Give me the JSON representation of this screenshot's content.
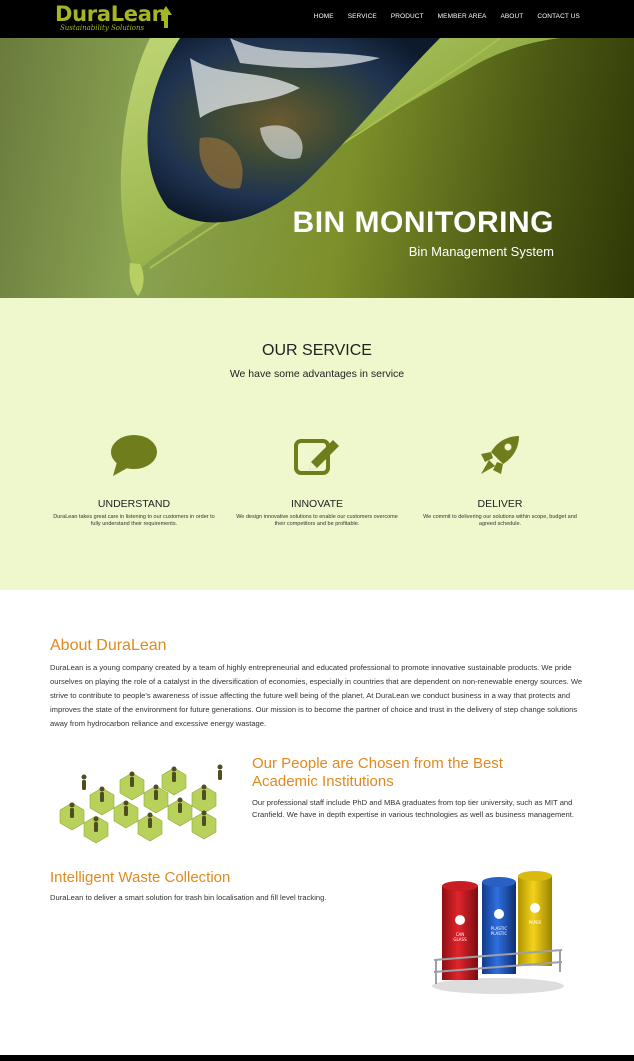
{
  "brand": {
    "name": "DuraLean",
    "tagline": "Sustainability Solutions"
  },
  "nav": {
    "items": [
      {
        "label": "HOME"
      },
      {
        "label": "SERVICE"
      },
      {
        "label": "PRODUCT"
      },
      {
        "label": "MEMBER AREA"
      },
      {
        "label": "ABOUT"
      },
      {
        "label": "CONTACT US"
      }
    ]
  },
  "hero": {
    "title": "BIN MONITORING",
    "subtitle": "Bin Management System"
  },
  "service": {
    "title": "OUR SERVICE",
    "subtitle": "We have some advantages in service",
    "features": [
      {
        "icon": "speech-bubble-icon",
        "title": "UNDERSTAND",
        "desc": "DuraLean takes great care in listening to our customers in order to fully understand their requirements."
      },
      {
        "icon": "edit-icon",
        "title": "INNOVATE",
        "desc": "We design innovative solutions to enable our customers overcome their competitors and be profitable."
      },
      {
        "icon": "rocket-icon",
        "title": "DELIVER",
        "desc": "We commit to delivering our solutions within scope, budget and agreed schedule."
      }
    ]
  },
  "about": {
    "title": "About DuraLean",
    "text": "DuraLean is a young company created by a team of highly entrepreneurial and educated professional to promote innovative sustainable products. We pride ourselves on playing the role of a catalyst in the diversification of economies, especially in countries that are dependent on non-renewable energy sources. We strive to contribute to people's awareness of issue affecting the future well being of the planet. At DuraLean we conduct business in a way that protects and improves the state of the environment for future generations. Our mission is to become the partner of choice and trust in the delivery of step change solutions away from hydrocarbon reliance and excessive energy wastage."
  },
  "people": {
    "title": "Our People are Chosen from the Best Academic Institutions",
    "text": "Our professional staff include PhD and MBA graduates from top tier university, such as MIT and Cranfield. We have in depth expertise in various technologies as well as business management."
  },
  "waste": {
    "title": "Intelligent Waste Collection",
    "text": "DuraLean to deliver a smart solution for trash bin localisation and fill level tracking.",
    "bin_labels": [
      "CAN GLASS",
      "PLASTIC PLASTIC",
      "PAPER"
    ]
  },
  "colors": {
    "accent": "#a7b524",
    "heading_orange": "#e08a1e",
    "service_bg": "#eff7cd",
    "icon_green": "#6f7d1c"
  }
}
